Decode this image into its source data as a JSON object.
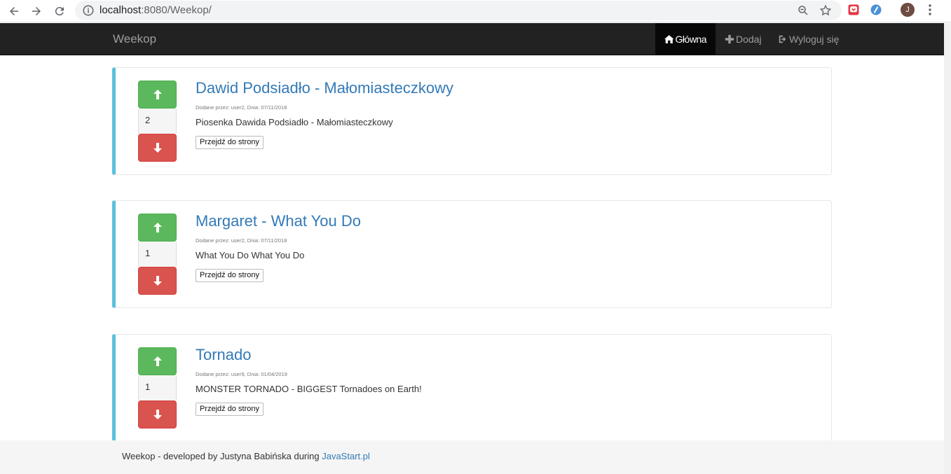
{
  "browser": {
    "url_host": "localhost",
    "url_rest": ":8080/Weekop/",
    "avatar_letter": "J"
  },
  "navbar": {
    "brand": "Weekop",
    "items": [
      {
        "label": "Główna",
        "icon": "home-icon",
        "active": true
      },
      {
        "label": "Dodaj",
        "icon": "plus-icon",
        "active": false
      },
      {
        "label": "Wyloguj się",
        "icon": "logout-icon",
        "active": false
      }
    ]
  },
  "posts": [
    {
      "title": "Dawid Podsiadło - Małomiasteczkowy",
      "meta": "Dodane przez: user2, Dnia: 07/11/2018",
      "description": "Piosenka Dawida Podsiadło - Małomiasteczkowy",
      "votes": "2",
      "link_label": "Przejdź do strony"
    },
    {
      "title": "Margaret - What You Do",
      "meta": "Dodane przez: user2, Dnia: 07/11/2018",
      "description": "What You Do What You Do",
      "votes": "1",
      "link_label": "Przejdź do strony"
    },
    {
      "title": "Tornado",
      "meta": "Dodane przez: user9, Dnia: 01/04/2019",
      "description": "MONSTER TORNADO - BIGGEST Tornadoes on Earth!",
      "votes": "1",
      "link_label": "Przejdź do strony"
    }
  ],
  "footer": {
    "text": "Weekop - developed by Justyna Babińska during ",
    "link": "JavaStart.pl"
  },
  "colors": {
    "upvote": "#5cb85c",
    "downvote": "#d9534f",
    "card_accent": "#5bc0de",
    "link": "#337ab7",
    "navbar": "#222222"
  }
}
